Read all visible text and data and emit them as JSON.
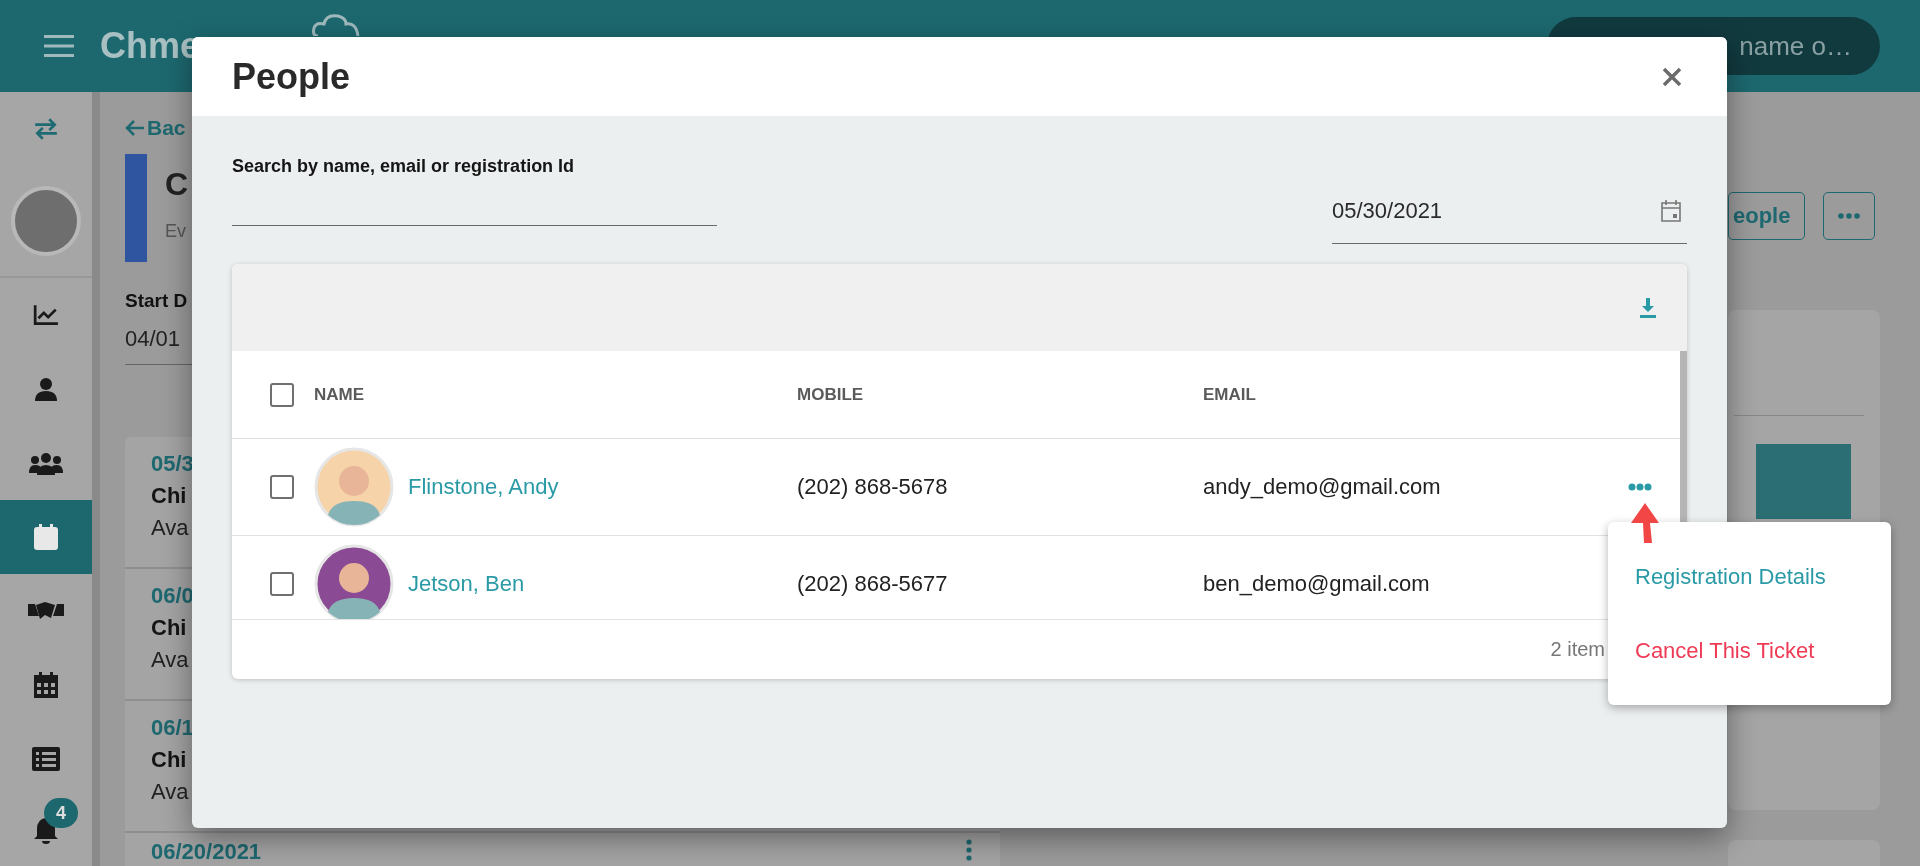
{
  "header": {
    "logo": "Chme",
    "search": "name o…"
  },
  "sidebar": {
    "items": [
      {
        "kind": "swap",
        "selected": false
      },
      {
        "kind": "avatar",
        "selected": false
      },
      {
        "kind": "chart",
        "selected": false
      },
      {
        "kind": "person",
        "selected": false
      },
      {
        "kind": "group",
        "selected": false
      },
      {
        "kind": "calendar",
        "selected": true
      },
      {
        "kind": "handshake",
        "selected": false
      },
      {
        "kind": "calendar-grid",
        "selected": false
      },
      {
        "kind": "list",
        "selected": false
      },
      {
        "kind": "bell",
        "selected": false,
        "badge": "4"
      }
    ]
  },
  "page": {
    "back": "Bac",
    "title": "C",
    "subtitle": "Ev",
    "start_label": "Start D",
    "start_value": "04/01",
    "people_button": "eople",
    "events": [
      {
        "date": "05/3",
        "name": "Chi",
        "status": "Ava"
      },
      {
        "date": "06/0",
        "name": "Chi",
        "status": "Ava"
      },
      {
        "date": "06/1",
        "name": "Chi",
        "status": "Ava"
      },
      {
        "date": "06/20/2021"
      }
    ]
  },
  "dialog": {
    "title": "People",
    "search": {
      "label": "Search by name, email or registration Id"
    },
    "date": "05/30/2021",
    "table": {
      "select_all": {
        "checked": false
      },
      "columns": [
        "NAME",
        "MOBILE",
        "EMAIL"
      ],
      "rows": [
        {
          "name": "Flinstone, Andy",
          "mobile": "(202) 868-5678",
          "email": "andy_demo@gmail.com",
          "checked": false,
          "color": "#f6d3a8",
          "menu_open": true
        },
        {
          "name": "Jetson, Ben",
          "mobile": "(202) 868-5677",
          "email": "ben_demo@gmail.com",
          "checked": false,
          "color": "#8a4a94",
          "menu_open": false
        }
      ],
      "footer": "2 item"
    },
    "menu": [
      {
        "label": "Registration Details",
        "kind": "action"
      },
      {
        "label": "Cancel This Ticket",
        "kind": "danger"
      }
    ]
  }
}
